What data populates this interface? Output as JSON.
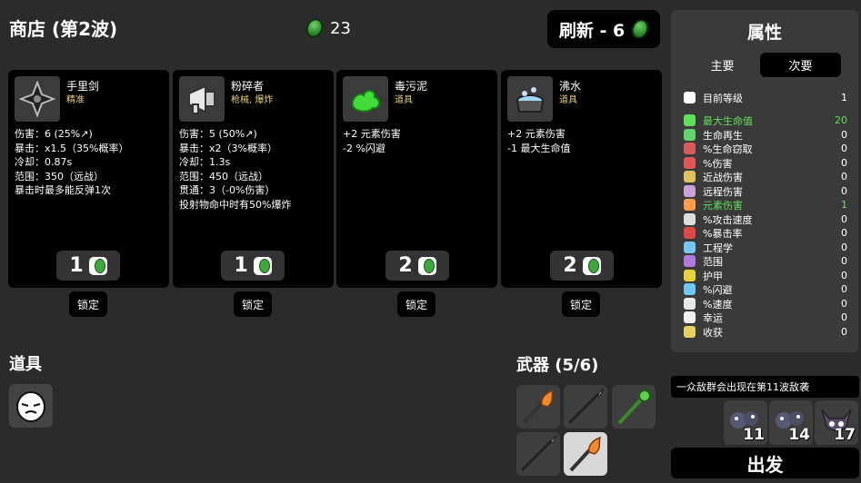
{
  "header": {
    "title": "商店 (第2波)",
    "materials": "23",
    "reroll_label": "刷新 - 6"
  },
  "shop": [
    {
      "name": "手里剑",
      "tag": "精准",
      "icon": "shuriken-icon",
      "stats": [
        "伤害：6 (25%↗)",
        "暴击：x1.5（35%概率）",
        "冷却：0.87s",
        "范围：350（远战）",
        "暴击时最多能反弹1次"
      ],
      "price": "1",
      "lock_label": "锁定"
    },
    {
      "name": "粉碎者",
      "tag": "枪械, 爆炸",
      "icon": "megaphone-icon",
      "stats": [
        "伤害：5 (50%↗)",
        "暴击：x2（3%概率）",
        "冷却：1.3s",
        "范围：450（远战）",
        "贯通：3（-0%伤害）",
        "投射物命中时有50%爆炸"
      ],
      "price": "1",
      "lock_label": "锁定"
    },
    {
      "name": "毒污泥",
      "tag": "道具",
      "icon": "slime-icon",
      "stats": [
        "+2 元素伤害",
        "-2 %闪避"
      ],
      "price": "2",
      "lock_label": "锁定"
    },
    {
      "name": "沸水",
      "tag": "道具",
      "icon": "boiling-pot-icon",
      "stats": [
        "+2 元素伤害",
        "-1 最大生命值"
      ],
      "price": "2",
      "lock_label": "锁定"
    }
  ],
  "items_section": {
    "title": "道具",
    "items": [
      "egg-face-icon"
    ]
  },
  "weapons_section": {
    "title": "武器 (5/6)",
    "weapons": [
      "torch-icon",
      "spear-icon",
      "green-staff-icon",
      "spear-icon",
      "torch-icon"
    ]
  },
  "attributes": {
    "title": "属性",
    "tabs": [
      "主要",
      "次要"
    ],
    "active_tab": "次要",
    "rows": [
      {
        "label": "目前等级",
        "value": "1",
        "icon": "level-icon",
        "color": "#ffffff"
      },
      {
        "label": "最大生命值",
        "value": "20",
        "icon": "heart-icon",
        "color": "#5fe05a",
        "highlight": true
      },
      {
        "label": "生命再生",
        "value": "0",
        "icon": "regen-icon",
        "color": "#62d36a"
      },
      {
        "label": "%生命窃取",
        "value": "0",
        "icon": "lifesteal-icon",
        "color": "#d85a5a"
      },
      {
        "label": "%伤害",
        "value": "0",
        "icon": "damage-icon",
        "color": "#e25555"
      },
      {
        "label": "近战伤害",
        "value": "0",
        "icon": "melee-icon",
        "color": "#e0c060"
      },
      {
        "label": "远程伤害",
        "value": "0",
        "icon": "ranged-icon",
        "color": "#c9a0d8"
      },
      {
        "label": "元素伤害",
        "value": "1",
        "icon": "elemental-icon",
        "color": "#ff9a4a",
        "highlight": true
      },
      {
        "label": "%攻击速度",
        "value": "0",
        "icon": "attack-speed-icon",
        "color": "#dddddd"
      },
      {
        "label": "%暴击率",
        "value": "0",
        "icon": "crit-icon",
        "color": "#e04848"
      },
      {
        "label": "工程学",
        "value": "0",
        "icon": "engineering-icon",
        "color": "#74c7f0"
      },
      {
        "label": "范围",
        "value": "0",
        "icon": "range-icon",
        "color": "#b07ae0"
      },
      {
        "label": "护甲",
        "value": "0",
        "icon": "armor-icon",
        "color": "#e8d23a"
      },
      {
        "label": "%闪避",
        "value": "0",
        "icon": "dodge-icon",
        "color": "#70c8f0"
      },
      {
        "label": "%速度",
        "value": "0",
        "icon": "speed-icon",
        "color": "#e8e8e8"
      },
      {
        "label": "幸运",
        "value": "0",
        "icon": "luck-icon",
        "color": "#f0f0f0"
      },
      {
        "label": "收获",
        "value": "0",
        "icon": "harvest-icon",
        "color": "#e8d060"
      }
    ]
  },
  "wave_notice": "一众敌群会出现在第11波敌袭",
  "enemies": [
    {
      "icon": "enemy-group-icon",
      "count": "11"
    },
    {
      "icon": "enemy-group-icon",
      "count": "14"
    },
    {
      "icon": "horned-boss-icon",
      "count": "17"
    }
  ],
  "go_label": "出发"
}
